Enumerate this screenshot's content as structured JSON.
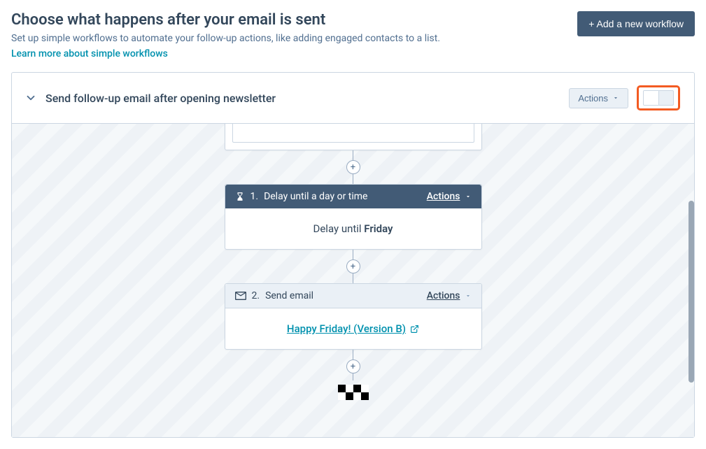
{
  "header": {
    "title": "Choose what happens after your email is sent",
    "subtitle": "Set up simple workflows to automate your follow-up actions, like adding engaged contacts to a list.",
    "learn_more": "Learn more about simple workflows",
    "add_workflow_label": "+ Add a new workflow"
  },
  "workflow_card": {
    "name": "Send follow-up email after opening newsletter",
    "actions_label": "Actions",
    "toggle_on": false
  },
  "steps": {
    "step1": {
      "index": "1.",
      "title": "Delay until a day or time",
      "actions_label": "Actions",
      "body_prefix": "Delay until ",
      "body_value": "Friday"
    },
    "step2": {
      "index": "2.",
      "title": "Send email",
      "actions_label": "Actions",
      "email_name": "Happy Friday! (Version B)"
    }
  },
  "icons": {
    "plus": "+",
    "caret_down": "▾"
  }
}
